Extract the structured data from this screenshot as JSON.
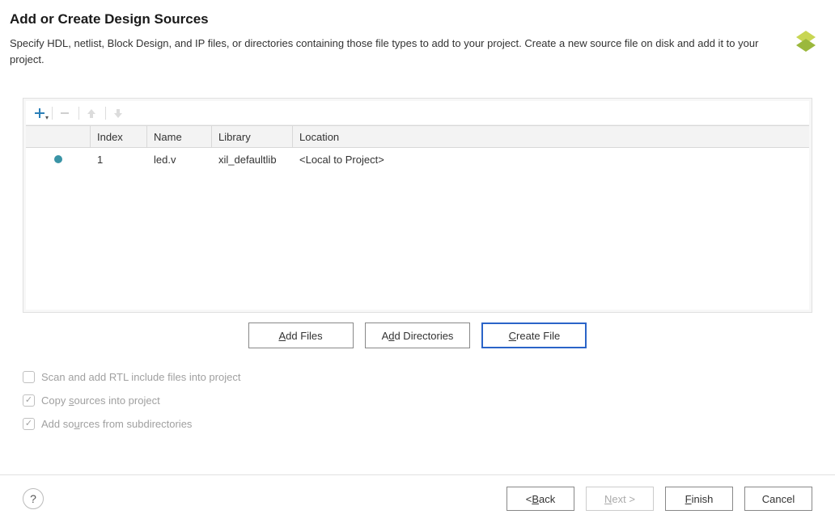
{
  "header": {
    "title": "Add or Create Design Sources",
    "subtitle": "Specify HDL, netlist, Block Design, and IP files, or directories containing those file types to add to your project. Create a new source file on disk and add it to your project."
  },
  "table": {
    "columns": {
      "index": "Index",
      "name": "Name",
      "library": "Library",
      "location": "Location"
    },
    "rows": [
      {
        "index": "1",
        "name": "led.v",
        "library": "xil_defaultlib",
        "location": "<Local to Project>"
      }
    ]
  },
  "actions": {
    "add_files": "Add Files",
    "add_directories": "Add Directories",
    "create_file": "Create File"
  },
  "options": {
    "scan_rtl": "Scan and add RTL include files into project",
    "copy_sources": "Copy sources into project",
    "add_subdirs": "Add sources from subdirectories"
  },
  "footer": {
    "back": "Back",
    "next": "Next >",
    "finish": "Finish",
    "cancel": "Cancel",
    "help": "?"
  }
}
